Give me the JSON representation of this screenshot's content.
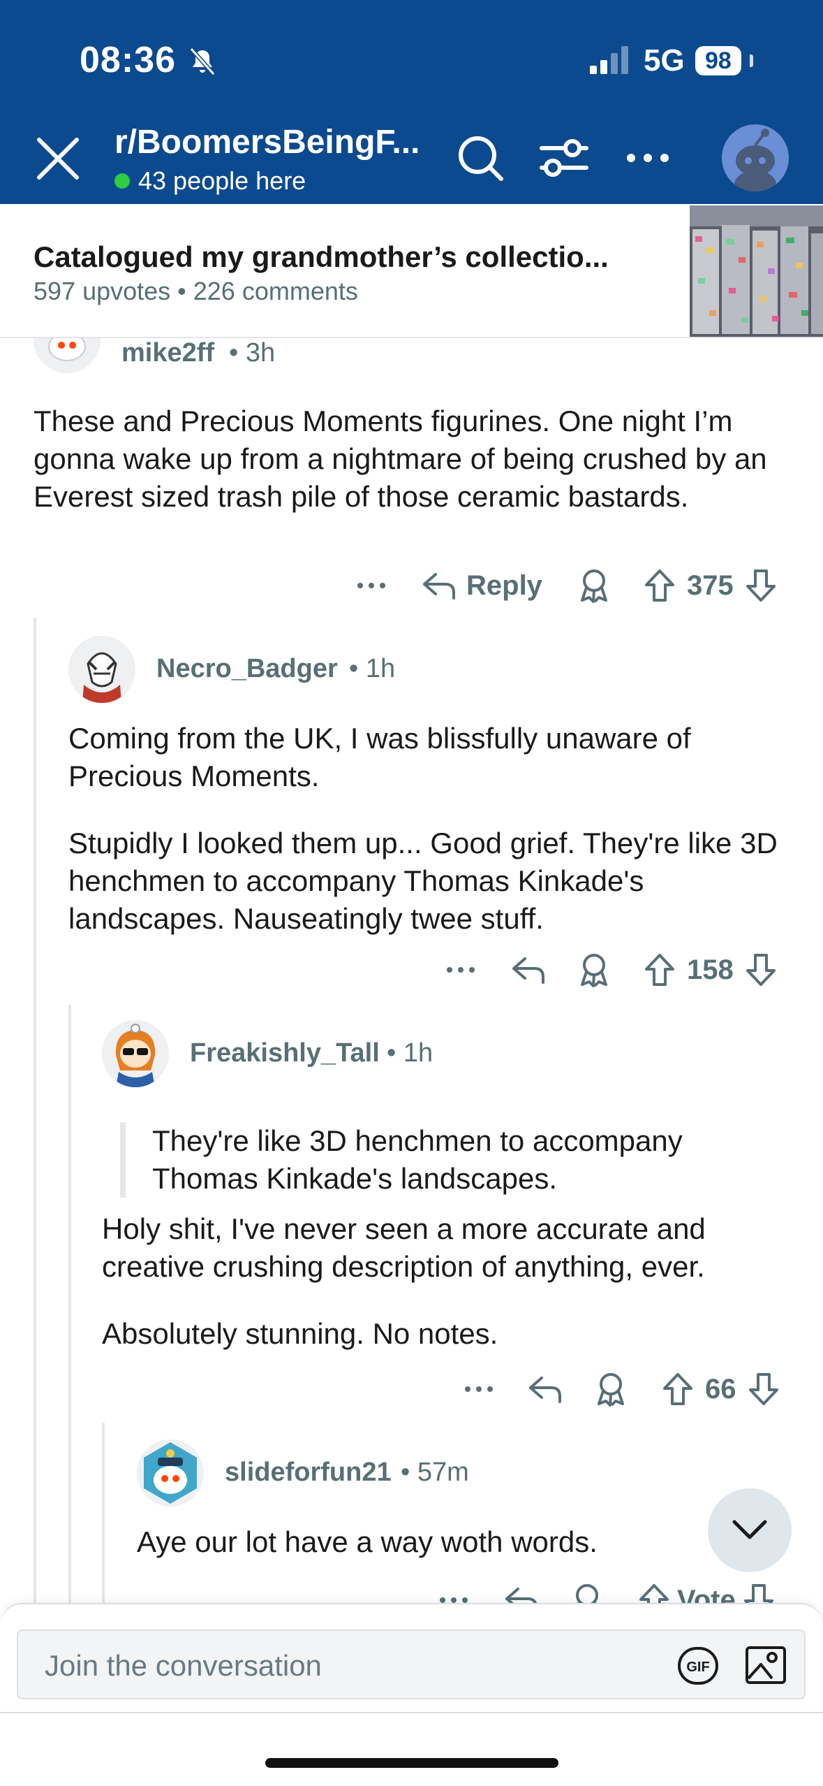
{
  "status_bar": {
    "time": "08:36",
    "network": "5G",
    "battery": "98"
  },
  "header": {
    "subreddit": "r/BoomersBeingF...",
    "online": "43 people here",
    "icons": [
      "close-icon",
      "search-icon",
      "filter-icon",
      "more-icon",
      "user-avatar"
    ]
  },
  "post": {
    "title": "Catalogued my grandmother’s collectio...",
    "meta": "597 upvotes • 226 comments"
  },
  "comments": [
    {
      "user": "mike2ff",
      "age": "3h",
      "body": [
        "These and Precious Moments figurines. One night I’m gonna wake up from a nightmare of being crushed by an Everest sized trash pile of those ceramic bastards."
      ],
      "reply_label": "Reply",
      "votes": "375"
    },
    {
      "user": "Necro_Badger",
      "age": "1h",
      "body": [
        "Coming from the UK, I was blissfully unaware of Precious Moments.",
        "Stupidly I looked them up... Good grief. They're like 3D henchmen to accompany Thomas Kinkade's landscapes. Nauseatingly twee stuff."
      ],
      "votes": "158"
    },
    {
      "user": "Freakishly_Tall",
      "age": "1h",
      "quote": "They're like 3D henchmen to accompany Thomas Kinkade's landscapes.",
      "body": [
        "Holy shit, I've never seen a more accurate and creative crushing description of anything, ever.",
        "Absolutely stunning.  No notes."
      ],
      "votes": "66"
    },
    {
      "user": "slideforfun21",
      "age": "57m",
      "body": [
        "Aye our lot have a way woth words."
      ],
      "votes": "Vote"
    }
  ],
  "composer": {
    "placeholder": "Join the conversation",
    "gif_label": "GIF"
  },
  "colors": {
    "header_bg": "#0c4a8f",
    "meta_text": "#576f76",
    "thread_line": "#e4e6e8",
    "online_dot": "#2ecc40"
  }
}
